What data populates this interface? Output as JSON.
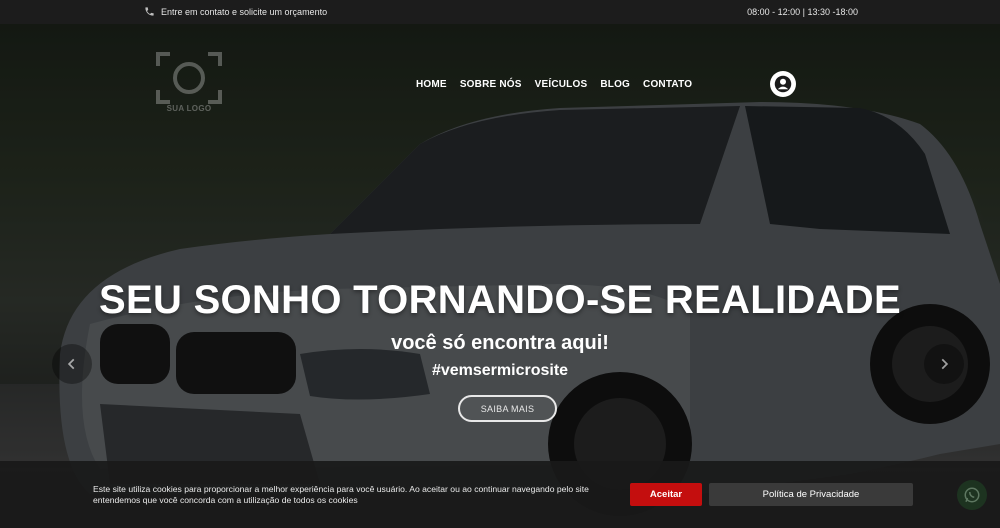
{
  "topbar": {
    "contact_text": "Entre em contato e solicite um orçamento",
    "hours": "08:00 - 12:00 | 13:30 -18:00"
  },
  "brand": {
    "logo_text": "SUA LOGO"
  },
  "nav": {
    "items": [
      {
        "label": "HOME"
      },
      {
        "label": "SOBRE NÓS"
      },
      {
        "label": "VEÍCULOS"
      },
      {
        "label": "BLOG"
      },
      {
        "label": "CONTATO"
      }
    ]
  },
  "hero": {
    "headline": "SEU SONHO TORNANDO-SE REALIDADE",
    "subline": "você só encontra aqui!",
    "hashtag": "#vemsermicrosite",
    "cta_label": "SAIBA MAIS"
  },
  "cookie": {
    "text": "Este site utiliza cookies para proporcionar a melhor experiência para você usuário. Ao aceitar ou ao continuar navegando pelo site entendemos que você concorda com a utilização de todos os cookies",
    "accept_label": "Aceitar",
    "policy_label": "Política de Privacidade"
  },
  "colors": {
    "accent": "#c40e0e",
    "topbar_bg": "#1c1c1c"
  },
  "icons": [
    "phone-icon",
    "user-icon",
    "chevron-left-icon",
    "chevron-right-icon",
    "whatsapp-icon"
  ]
}
